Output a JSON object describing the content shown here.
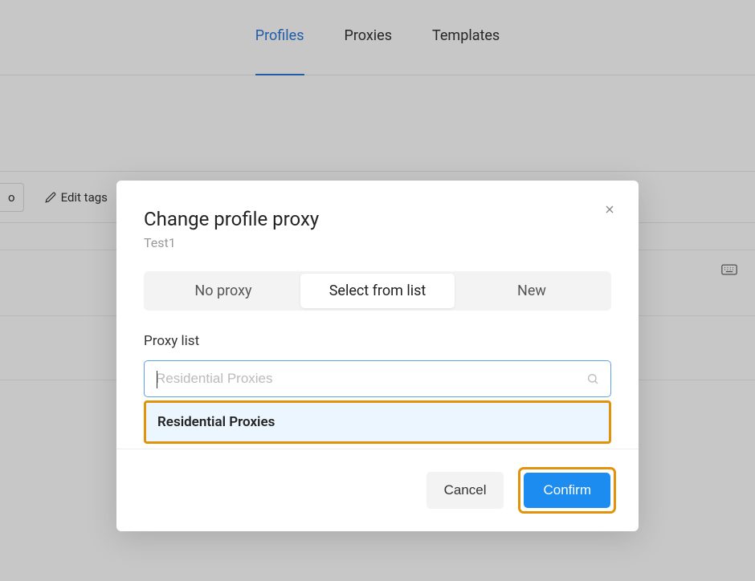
{
  "tabs": {
    "profiles": "Profiles",
    "proxies": "Proxies",
    "templates": "Templates"
  },
  "toolbar": {
    "truncated": "o",
    "edit_tags": "Edit tags"
  },
  "modal": {
    "title": "Change profile proxy",
    "subtitle": "Test1",
    "segments": {
      "no_proxy": "No proxy",
      "select_from_list": "Select from list",
      "new": "New"
    },
    "proxy_list_label": "Proxy list",
    "search_placeholder": "Residential Proxies",
    "dropdown_option": "Residential Proxies",
    "cancel": "Cancel",
    "confirm": "Confirm"
  }
}
